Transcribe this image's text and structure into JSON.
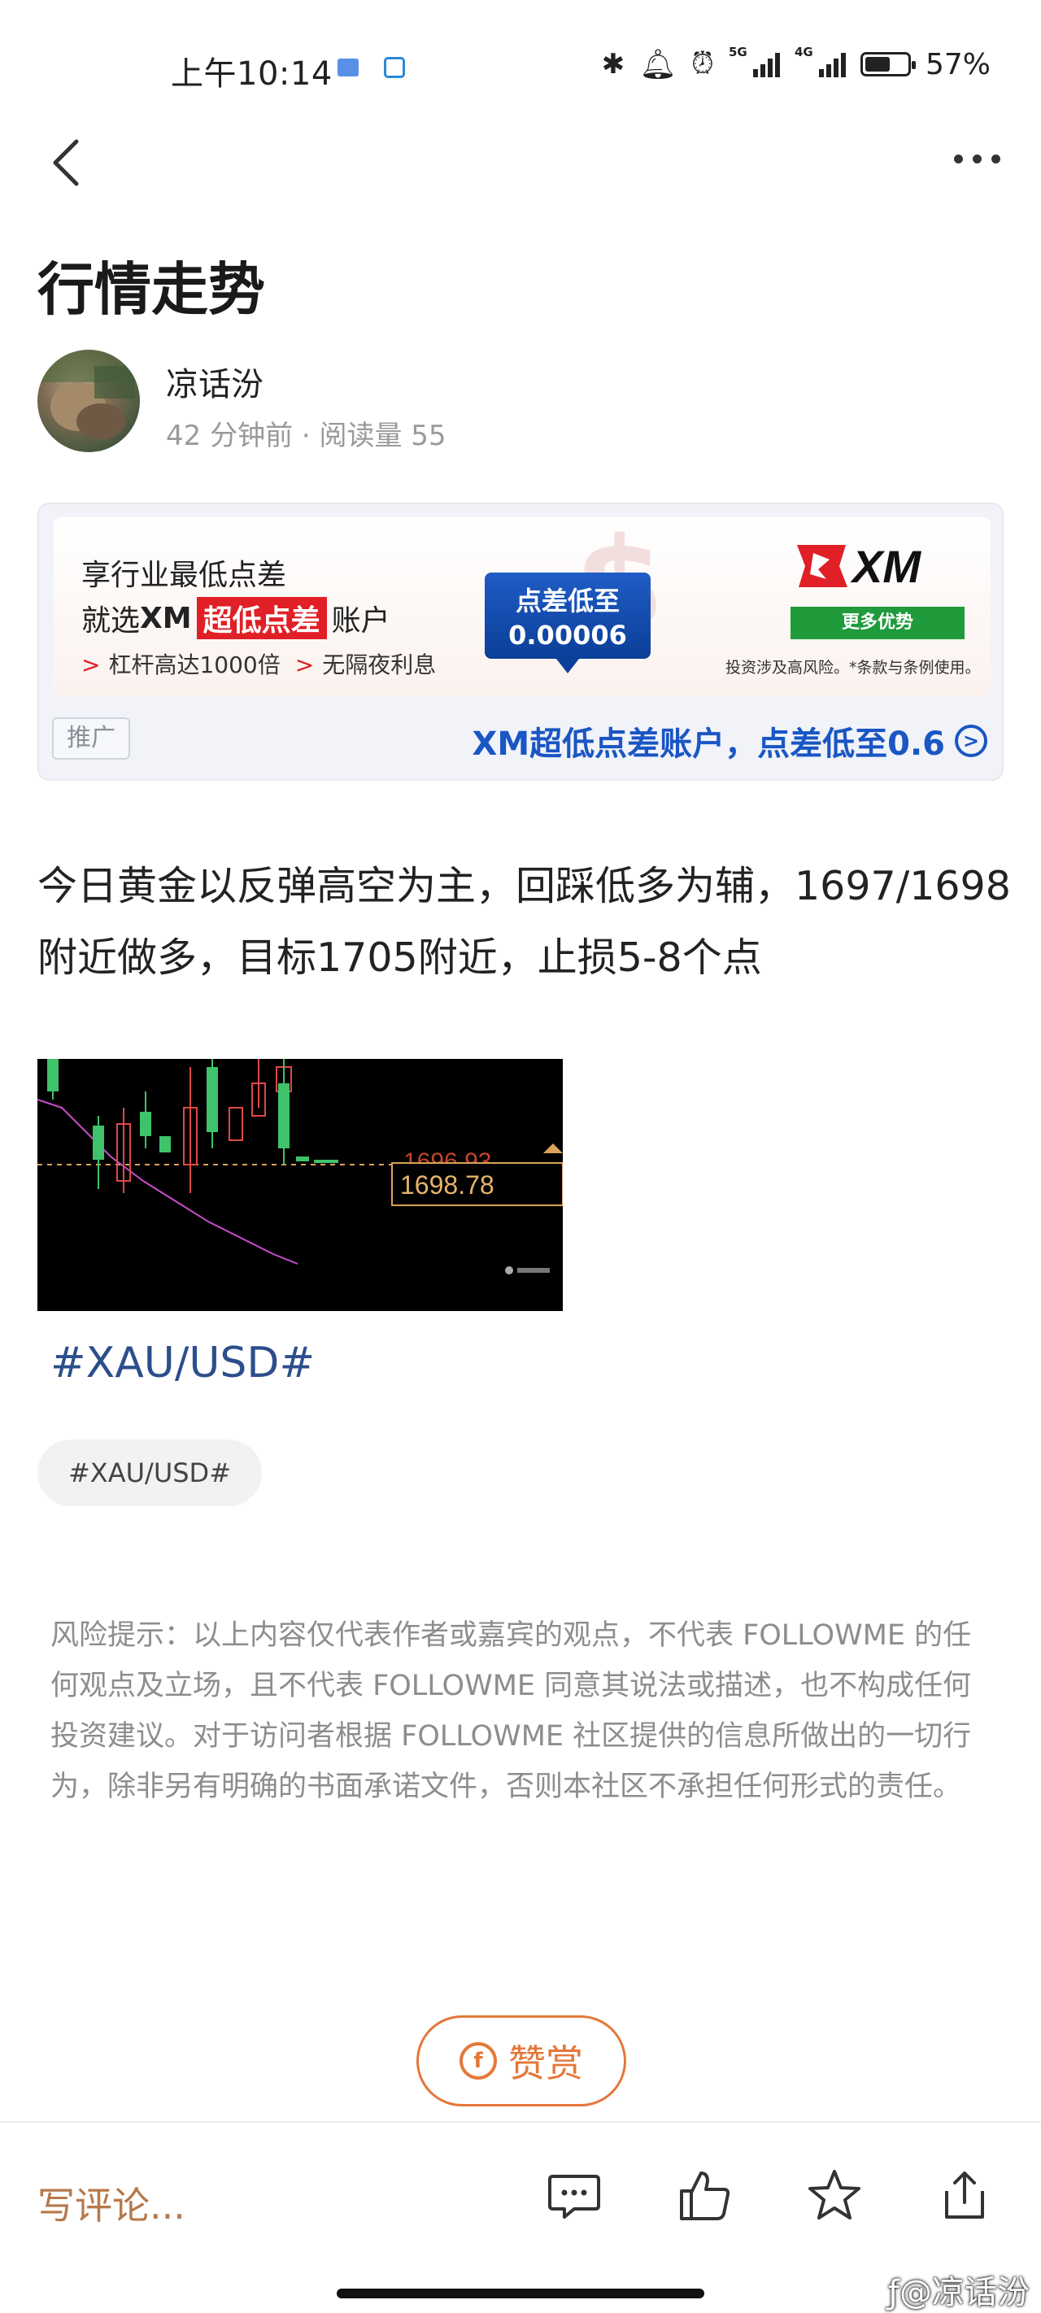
{
  "status_bar": {
    "time": "上午10:14",
    "signal1": "5G",
    "signal2": "4G",
    "battery": "57%"
  },
  "article": {
    "title": "行情走势",
    "author": "凉话汾",
    "meta": "42 分钟前 · 阅读量 55",
    "paragraph": "今日黄金以反弹高空为主，回踩低多为辅，1697/1698附近做多，目标1705附近，止损5-8个点",
    "hashtag_link": "#XAU/USD#",
    "tag_chip": "#XAU/USD#",
    "disclaimer": "风险提示：以上内容仅代表作者或嘉宾的观点，不代表 FOLLOWME 的任何观点及立场，且不代表 FOLLOWME 同意其说法或描述，也不构成任何投资建议。对于访问者根据 FOLLOWME 社区提供的信息所做出的一切行为，除非另有明确的书面承诺文件，否则本社区不承担任何形式的责任。"
  },
  "ad": {
    "line1": "享行业最低点差",
    "line2_pre": "就选",
    "line2_brand": "XM",
    "line2_highlight": "超低点差",
    "line2_post": "账户",
    "feature1": "杠杆高达1000倍",
    "feature2": "无隔夜利息",
    "badge_line1": "点差低至",
    "badge_line2": "0.00006",
    "logo_text": "XM",
    "more_button": "更多优势",
    "risk_note": "投资涉及高风险。*条款与条例使用。",
    "tag": "推广",
    "link_text": "XM超低点差账户，点差低至0.6"
  },
  "chart_image": {
    "price_label": "1698.78",
    "obscured_label": "1696.93"
  },
  "reward_button": "赞赏",
  "bottom_bar": {
    "comment_placeholder": "写评论...",
    "watermark": "@凉话汾"
  },
  "colors": {
    "accent_orange": "#e4783a",
    "link_blue": "#1a56c4",
    "hashtag_blue": "#2c4e8c",
    "ad_red": "#e01f26",
    "xm_green": "#1f9b3c"
  }
}
